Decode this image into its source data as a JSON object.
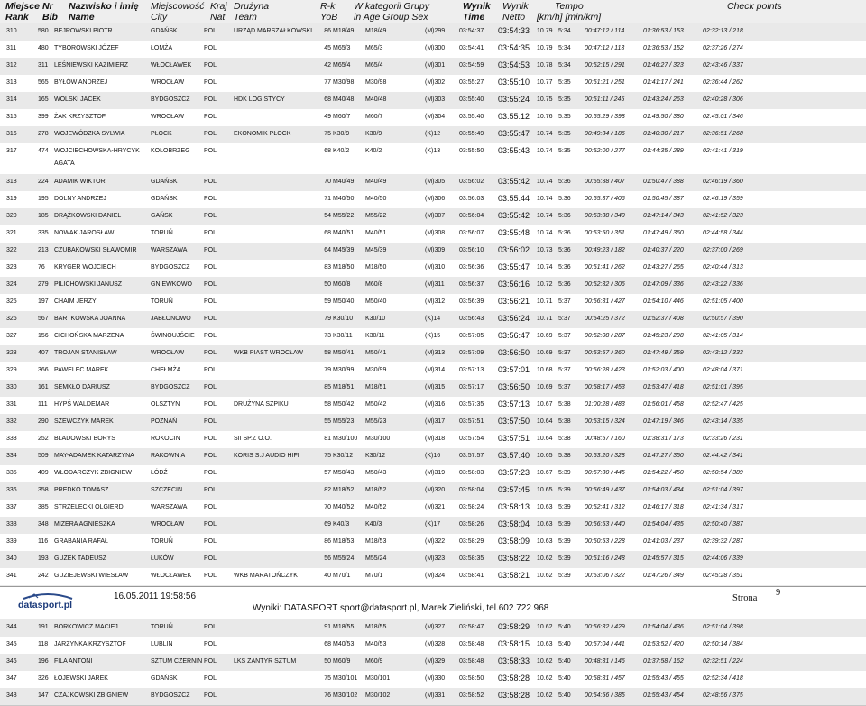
{
  "header": {
    "miejsce": "Miejsce",
    "nr": "Nr",
    "nazwisko": "Nazwisko i imię",
    "miejscowosc": "Miejscowość",
    "kraj": "Kraj",
    "druzyna": "Drużyna",
    "rk": "R-k",
    "wkat": "W kategorii Grupy",
    "wynik_b": "Wynik",
    "wynik": "Wynik",
    "tempo": "Tempo",
    "check": "Check points",
    "rank": "Rank",
    "bib": "Bib",
    "name": "Name",
    "city": "City",
    "nat": "Nat",
    "team": "Team",
    "yob": "YoB",
    "inage": "in Age Group Sex",
    "time": "Time",
    "netto": "Netto",
    "units": "[km/h] [min/km]"
  },
  "rows": [
    [
      "310",
      "580",
      "BEJROWSKI PIOTR",
      "GDAŃSK",
      "POL",
      "URZĄD MARSZAŁKOWSKI",
      "86",
      "M18/49",
      "M18/49",
      "(M)299",
      "03:54:37",
      "03:54:33",
      "10.79",
      "5:34",
      "00:47:12 / 114",
      "01:36:53 / 153",
      "02:32:13 / 218"
    ],
    [
      "311",
      "480",
      "TYBOROWSKI JÓZEF",
      "ŁOMŻA",
      "POL",
      "",
      "45",
      "M65/3",
      "M65/3",
      "(M)300",
      "03:54:41",
      "03:54:35",
      "10.79",
      "5:34",
      "00:47:12 / 113",
      "01:36:53 / 152",
      "02:37:26 / 274"
    ],
    [
      "312",
      "311",
      "LEŚNIEWSKI KAZIMIERZ",
      "WŁOCŁAWEK",
      "POL",
      "",
      "42",
      "M65/4",
      "M65/4",
      "(M)301",
      "03:54:59",
      "03:54:53",
      "10.78",
      "5:34",
      "00:52:15 / 291",
      "01:46:27 / 323",
      "02:43:46 / 337"
    ],
    [
      "313",
      "565",
      "BYŁÓW ANDRZEJ",
      "WROCŁAW",
      "POL",
      "",
      "77",
      "M30/98",
      "M30/98",
      "(M)302",
      "03:55:27",
      "03:55:10",
      "10.77",
      "5:35",
      "00:51:21 / 251",
      "01:41:17 / 241",
      "02:36:44 / 262"
    ],
    [
      "314",
      "165",
      "WOLSKI JACEK",
      "BYDGOSZCZ",
      "POL",
      "HDK LOGISTYCY",
      "68",
      "M40/48",
      "M40/48",
      "(M)303",
      "03:55:40",
      "03:55:24",
      "10.75",
      "5:35",
      "00:51:11 / 245",
      "01:43:24 / 263",
      "02:40:28 / 306"
    ],
    [
      "315",
      "399",
      "ŻAK KRZYSZTOF",
      "WROCŁAW",
      "POL",
      "",
      "49",
      "M60/7",
      "M60/7",
      "(M)304",
      "03:55:40",
      "03:55:12",
      "10.76",
      "5:35",
      "00:55:29 / 398",
      "01:49:50 / 380",
      "02:45:01 / 346"
    ],
    [
      "316",
      "278",
      "WOJEWÓDZKA SYLWIA",
      "PŁOCK",
      "POL",
      "EKONOMIK PŁOCK",
      "75",
      "K30/9",
      "K30/9",
      "(K)12",
      "03:55:49",
      "03:55:47",
      "10.74",
      "5:35",
      "00:49:34 / 186",
      "01:40:30 / 217",
      "02:36:51 / 268"
    ],
    [
      "317",
      "474",
      "WOJCIECHOWSKA-HRYCYK AGATA",
      "KOŁOBRZEG",
      "POL",
      "",
      "68",
      "K40/2",
      "K40/2",
      "(K)13",
      "03:55:50",
      "03:55:43",
      "10.74",
      "5:35",
      "00:52:00 / 277",
      "01:44:35 / 289",
      "02:41:41 / 319"
    ],
    [
      "318",
      "224",
      "ADAMIK WIKTOR",
      "GDAŃSK",
      "POL",
      "",
      "70",
      "M40/49",
      "M40/49",
      "(M)305",
      "03:56:02",
      "03:55:42",
      "10.74",
      "5:36",
      "00:55:38 / 407",
      "01:50:47 / 388",
      "02:46:19 / 360"
    ],
    [
      "319",
      "195",
      "DOLNY ANDRZEJ",
      "GDAŃSK",
      "POL",
      "",
      "71",
      "M40/50",
      "M40/50",
      "(M)306",
      "03:56:03",
      "03:55:44",
      "10.74",
      "5:36",
      "00:55:37 / 406",
      "01:50:45 / 387",
      "02:46:19 / 359"
    ],
    [
      "320",
      "185",
      "DRĄŻKOWSKI DANIEL",
      "GAŃSK",
      "POL",
      "",
      "54",
      "M55/22",
      "M55/22",
      "(M)307",
      "03:56:04",
      "03:55:42",
      "10.74",
      "5:36",
      "00:53:38 / 340",
      "01:47:14 / 343",
      "02:41:52 / 323"
    ],
    [
      "321",
      "335",
      "NOWAK JAROSŁAW",
      "TORUŃ",
      "POL",
      "",
      "68",
      "M40/51",
      "M40/51",
      "(M)308",
      "03:56:07",
      "03:55:48",
      "10.74",
      "5:36",
      "00:53:50 / 351",
      "01:47:49 / 360",
      "02:44:58 / 344"
    ],
    [
      "322",
      "213",
      "CZUBAKOWSKI SŁAWOMIR",
      "WARSZAWA",
      "POL",
      "",
      "64",
      "M45/39",
      "M45/39",
      "(M)309",
      "03:56:10",
      "03:56:02",
      "10.73",
      "5:36",
      "00:49:23 / 182",
      "01:40:37 / 220",
      "02:37:00 / 269"
    ],
    [
      "323",
      "76",
      "KRYGER WOJCIECH",
      "BYDGOSZCZ",
      "POL",
      "",
      "83",
      "M18/50",
      "M18/50",
      "(M)310",
      "03:56:36",
      "03:55:47",
      "10.74",
      "5:36",
      "00:51:41 / 262",
      "01:43:27 / 265",
      "02:40:44 / 313"
    ],
    [
      "324",
      "279",
      "PILICHOWSKI JANUSZ",
      "GNIEWKOWO",
      "POL",
      "",
      "50",
      "M60/8",
      "M60/8",
      "(M)311",
      "03:56:37",
      "03:56:16",
      "10.72",
      "5:36",
      "00:52:32 / 306",
      "01:47:09 / 336",
      "02:43:22 / 336"
    ],
    [
      "325",
      "197",
      "CHAIM JERZY",
      "TORUŃ",
      "POL",
      "",
      "59",
      "M50/40",
      "M50/40",
      "(M)312",
      "03:56:39",
      "03:56:21",
      "10.71",
      "5:37",
      "00:56:31 / 427",
      "01:54:10 / 446",
      "02:51:05 / 400"
    ],
    [
      "326",
      "567",
      "BARTKOWSKA JOANNA",
      "JABŁONOWO",
      "POL",
      "",
      "79",
      "K30/10",
      "K30/10",
      "(K)14",
      "03:56:43",
      "03:56:24",
      "10.71",
      "5:37",
      "00:54:25 / 372",
      "01:52:37 / 408",
      "02:50:57 / 390"
    ],
    [
      "327",
      "156",
      "CICHOŃSKA MARZENA",
      "ŚWINOUJŚCIE",
      "POL",
      "",
      "73",
      "K30/11",
      "K30/11",
      "(K)15",
      "03:57:05",
      "03:56:47",
      "10.69",
      "5:37",
      "00:52:08 / 287",
      "01:45:23 / 298",
      "02:41:05 / 314"
    ],
    [
      "328",
      "407",
      "TROJAN STANISŁAW",
      "WROCŁAW",
      "POL",
      "WKB PIAST WROCŁAW",
      "58",
      "M50/41",
      "M50/41",
      "(M)313",
      "03:57:09",
      "03:56:50",
      "10.69",
      "5:37",
      "00:53:57 / 360",
      "01:47:49 / 359",
      "02:43:12 / 333"
    ],
    [
      "329",
      "366",
      "PAWELEC MAREK",
      "CHEŁMŻA",
      "POL",
      "",
      "79",
      "M30/99",
      "M30/99",
      "(M)314",
      "03:57:13",
      "03:57:01",
      "10.68",
      "5:37",
      "00:56:28 / 423",
      "01:52:03 / 400",
      "02:48:04 / 371"
    ],
    [
      "330",
      "161",
      "SEMKŁO DARIUSZ",
      "BYDGOSZCZ",
      "POL",
      "",
      "85",
      "M18/51",
      "M18/51",
      "(M)315",
      "03:57:17",
      "03:56:50",
      "10.69",
      "5:37",
      "00:58:17 / 453",
      "01:53:47 / 418",
      "02:51:01 / 395"
    ],
    [
      "331",
      "111",
      "HYPŚ WALDEMAR",
      "OLSZTYN",
      "POL",
      "DRUŻYNA SZPIKU",
      "58",
      "M50/42",
      "M50/42",
      "(M)316",
      "03:57:35",
      "03:57:13",
      "10.67",
      "5:38",
      "01:00:28 / 483",
      "01:56:01 / 458",
      "02:52:47 / 425"
    ],
    [
      "332",
      "290",
      "SZEWCZYK MAREK",
      "POZNAŃ",
      "POL",
      "",
      "55",
      "M55/23",
      "M55/23",
      "(M)317",
      "03:57:51",
      "03:57:50",
      "10.64",
      "5:38",
      "00:53:15 / 324",
      "01:47:19 / 346",
      "02:43:14 / 335"
    ],
    [
      "333",
      "252",
      "BLADOWSKI BORYS",
      "ROKOCIN",
      "POL",
      "SII SP.Z O.O.",
      "81",
      "M30/100",
      "M30/100",
      "(M)318",
      "03:57:54",
      "03:57:51",
      "10.64",
      "5:38",
      "00:48:57 / 160",
      "01:38:31 / 173",
      "02:33:26 / 231"
    ],
    [
      "334",
      "509",
      "MAY-ADAMEK KATARZYNA",
      "RAKOWNIA",
      "POL",
      "KORIS S.J AUDIO HIFI",
      "75",
      "K30/12",
      "K30/12",
      "(K)16",
      "03:57:57",
      "03:57:40",
      "10.65",
      "5:38",
      "00:53:20 / 328",
      "01:47:27 / 350",
      "02:44:42 / 341"
    ],
    [
      "335",
      "409",
      "WŁODARCZYK ZBIGNIEW",
      "ŁÓDŹ",
      "POL",
      "",
      "57",
      "M50/43",
      "M50/43",
      "(M)319",
      "03:58:03",
      "03:57:23",
      "10.67",
      "5:39",
      "00:57:30 / 445",
      "01:54:22 / 450",
      "02:50:54 / 389"
    ],
    [
      "336",
      "358",
      "PREDKO TOMASZ",
      "SZCZECIN",
      "POL",
      "",
      "82",
      "M18/52",
      "M18/52",
      "(M)320",
      "03:58:04",
      "03:57:45",
      "10.65",
      "5:39",
      "00:56:49 / 437",
      "01:54:03 / 434",
      "02:51:04 / 397"
    ],
    [
      "337",
      "385",
      "STRZELECKI OLGIERD",
      "WARSZAWA",
      "POL",
      "",
      "70",
      "M40/52",
      "M40/52",
      "(M)321",
      "03:58:24",
      "03:58:13",
      "10.63",
      "5:39",
      "00:52:41 / 312",
      "01:46:17 / 318",
      "02:41:34 / 317"
    ],
    [
      "338",
      "348",
      "MIZERA AGNIESZKA",
      "WROCŁAW",
      "POL",
      "",
      "69",
      "K40/3",
      "K40/3",
      "(K)17",
      "03:58:26",
      "03:58:04",
      "10.63",
      "5:39",
      "00:56:53 / 440",
      "01:54:04 / 435",
      "02:50:40 / 387"
    ],
    [
      "339",
      "116",
      "GRABANIA RAFAŁ",
      "TORUŃ",
      "POL",
      "",
      "86",
      "M18/53",
      "M18/53",
      "(M)322",
      "03:58:29",
      "03:58:09",
      "10.63",
      "5:39",
      "00:50:53 / 228",
      "01:41:03 / 237",
      "02:39:32 / 287"
    ],
    [
      "340",
      "193",
      "GUZEK TADEUSZ",
      "ŁUKÓW",
      "POL",
      "",
      "56",
      "M55/24",
      "M55/24",
      "(M)323",
      "03:58:35",
      "03:58:22",
      "10.62",
      "5:39",
      "00:51:16 / 248",
      "01:45:57 / 315",
      "02:44:06 / 339"
    ],
    [
      "341",
      "242",
      "GUZIEJEWSKI WIESŁAW",
      "WŁOCŁAWEK",
      "POL",
      "WKB MARATOŃCZYK",
      "40",
      "M70/1",
      "M70/1",
      "(M)324",
      "03:58:41",
      "03:58:21",
      "10.62",
      "5:39",
      "00:53:06 / 322",
      "01:47:26 / 349",
      "02:45:28 / 351"
    ],
    [
      "342",
      "249",
      "BRONOWICKI ADAM",
      "RUMIA",
      "POL",
      "",
      "62",
      "M45/41",
      "M45/41",
      "(M)325",
      "03:58:41",
      "03:58:13",
      "10.63",
      "5:39",
      "00:53:05 / 319",
      "01:45:56 / 313",
      "02:41:51 / 321"
    ],
    [
      "343",
      "190",
      "CHYLEŃSKI RAFAŁ",
      "TORUŃ",
      "POL",
      "",
      "91",
      "M18/54",
      "M18/54",
      "(M)326",
      "03:58:45",
      "03:58:27",
      "10.62",
      "5:39",
      "00:56:32 / 430",
      "01:54:04 / 437",
      "02:51:05 / 401"
    ],
    [
      "344",
      "191",
      "BORKOWICZ MACIEJ",
      "TORUŃ",
      "POL",
      "",
      "91",
      "M18/55",
      "M18/55",
      "(M)327",
      "03:58:47",
      "03:58:29",
      "10.62",
      "5:40",
      "00:56:32 / 429",
      "01:54:04 / 436",
      "02:51:04 / 398"
    ],
    [
      "345",
      "118",
      "JARZYNKA KRZYSZTOF",
      "LUBLIN",
      "POL",
      "",
      "68",
      "M40/53",
      "M40/53",
      "(M)328",
      "03:58:48",
      "03:58:15",
      "10.63",
      "5:40",
      "00:57:04 / 441",
      "01:53:52 / 420",
      "02:50:14 / 384"
    ],
    [
      "346",
      "196",
      "FILA ANTONI",
      "SZTUM CZERNIN",
      "POL",
      "LKS ZANTYR SZTUM",
      "50",
      "M60/9",
      "M60/9",
      "(M)329",
      "03:58:48",
      "03:58:33",
      "10.62",
      "5:40",
      "00:48:31 / 146",
      "01:37:58 / 162",
      "02:32:51 / 224"
    ],
    [
      "347",
      "326",
      "ŁOJEWSKI JAREK",
      "GDAŃSK",
      "POL",
      "",
      "75",
      "M30/101",
      "M30/101",
      "(M)330",
      "03:58:50",
      "03:58:28",
      "10.62",
      "5:40",
      "00:58:31 / 457",
      "01:55:43 / 455",
      "02:52:34 / 418"
    ],
    [
      "348",
      "147",
      "CZAJKOWSKI ZBIGNIEW",
      "BYDGOSZCZ",
      "POL",
      "",
      "76",
      "M30/102",
      "M30/102",
      "(M)331",
      "03:58:52",
      "03:58:28",
      "10.62",
      "5:40",
      "00:54:56 / 385",
      "01:55:43 / 454",
      "02:48:56 / 375"
    ]
  ],
  "footer": {
    "logo": "datasport.pl",
    "date": "16.05.2011 19:58:56",
    "info": "Wyniki: DATASPORT sport@datasport.pl, Marek Zieliński, tel.602 722 968",
    "page_label": "Strona",
    "page_num": "9"
  }
}
